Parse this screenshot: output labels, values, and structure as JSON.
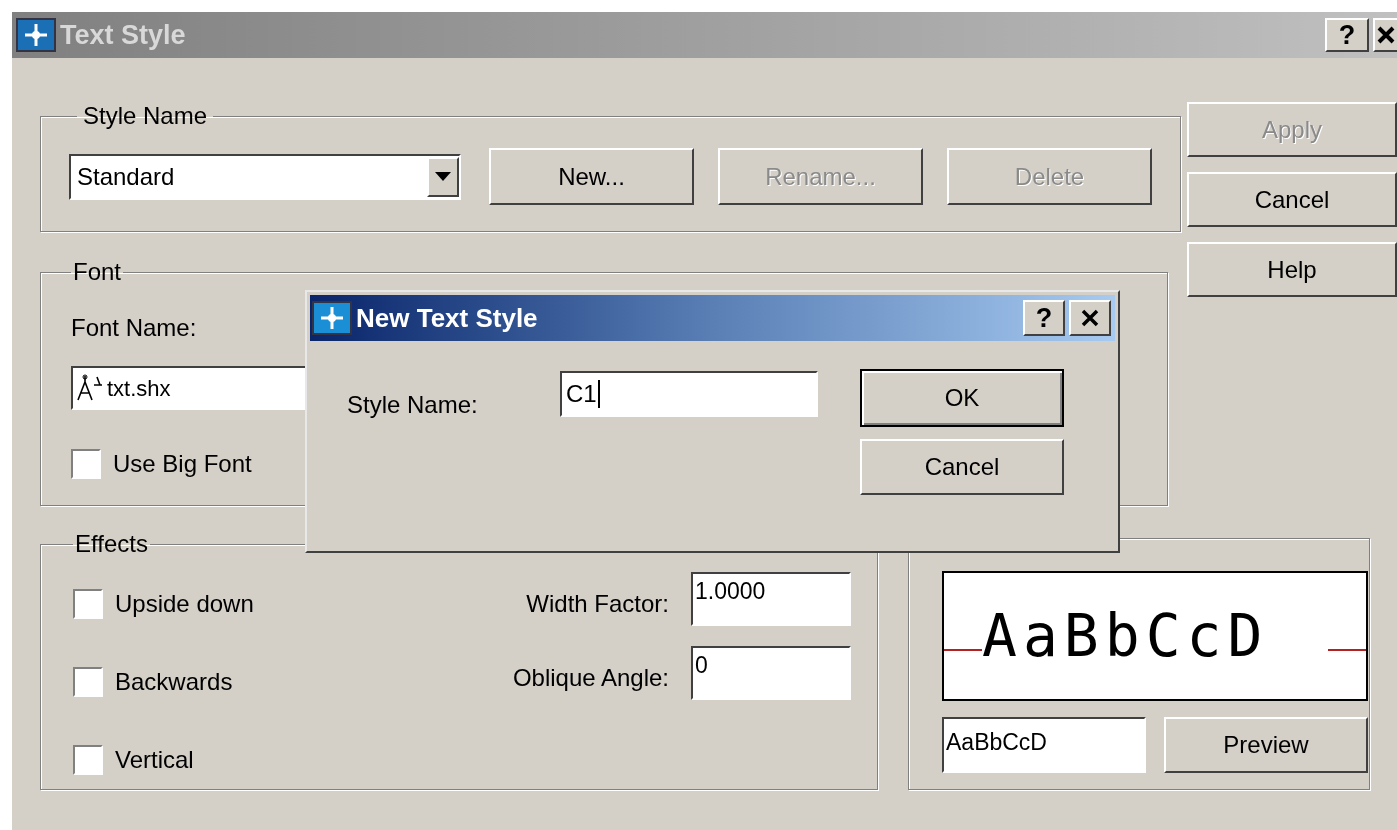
{
  "window": {
    "title": "Text Style",
    "help": "?"
  },
  "style_name": {
    "title": "Style Name",
    "value": "Standard",
    "buttons": [
      {
        "label": "New...",
        "disabled": false
      },
      {
        "label": "Rename...",
        "disabled": true
      },
      {
        "label": "Delete",
        "disabled": true
      }
    ]
  },
  "side_buttons": [
    {
      "label": "Apply",
      "disabled": true
    },
    {
      "label": "Cancel",
      "disabled": false
    },
    {
      "label": "Help",
      "disabled": false
    }
  ],
  "font": {
    "title": "Font",
    "font_name_label": "Font Name:",
    "font_value": "txt.shx",
    "big_font": {
      "label": "Use Big Font",
      "checked": false
    }
  },
  "effects": {
    "title": "Effects",
    "checkboxes": [
      {
        "label": "Upside down",
        "checked": false
      },
      {
        "label": "Backwards",
        "checked": false
      },
      {
        "label": "Vertical",
        "checked": false
      }
    ],
    "fields": [
      {
        "label": "Width Factor:",
        "value": "1.0000"
      },
      {
        "label": "Oblique Angle:",
        "value": "0"
      }
    ]
  },
  "preview": {
    "sample": "AaBbCcD",
    "input_value": "AaBbCcD",
    "button": {
      "label": "Preview"
    }
  },
  "dialog": {
    "title": "New Text Style",
    "help": "?",
    "label": "Style Name:",
    "value": "C1",
    "focused": true,
    "ok": "OK",
    "cancel": "Cancel"
  }
}
